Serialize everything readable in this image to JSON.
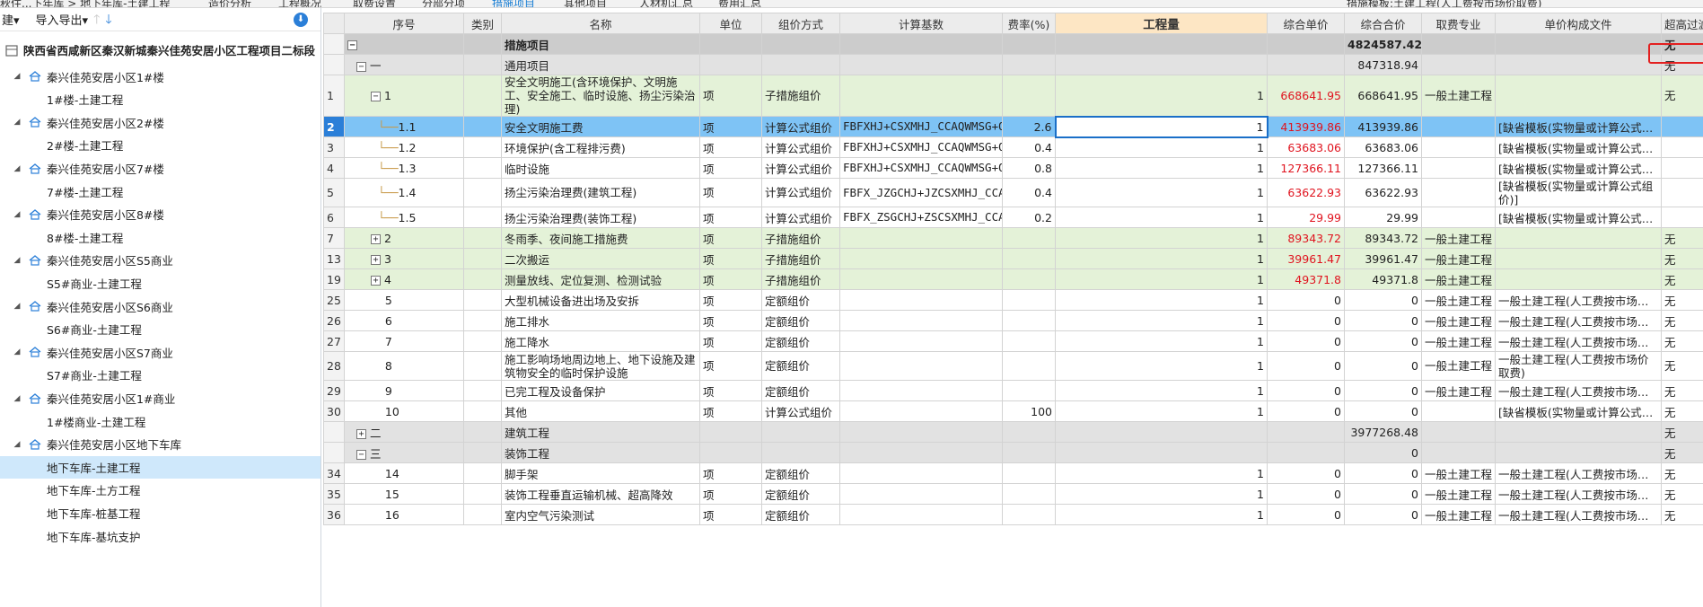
{
  "top_tabs": [
    {
      "label": "秋住...下年库 > 地下年库-土建工程",
      "active": false
    },
    {
      "label": "造价分析",
      "active": false
    },
    {
      "label": "工程概况",
      "active": false
    },
    {
      "label": "取费设置",
      "active": false
    },
    {
      "label": "分部分项",
      "active": false
    },
    {
      "label": "措施项目",
      "active": true
    },
    {
      "label": "其他项目",
      "active": false
    },
    {
      "label": "人材机汇总",
      "active": false
    },
    {
      "label": "费用汇总",
      "active": false
    },
    {
      "label": "措施模板:土建工程(人工费按市场价取费)",
      "active": false
    }
  ],
  "left_toolbar": {
    "menu_label": "建▾",
    "import_export_label": "导入导出▾"
  },
  "tree": {
    "root": "陕西省西咸新区秦汉新城秦兴佳苑安居小区工程项目二标段",
    "groups": [
      {
        "label": "秦兴佳苑安居小区1#楼",
        "children": [
          "1#楼-土建工程"
        ]
      },
      {
        "label": "秦兴佳苑安居小区2#楼",
        "children": [
          "2#楼-土建工程"
        ]
      },
      {
        "label": "秦兴佳苑安居小区7#楼",
        "children": [
          "7#楼-土建工程"
        ]
      },
      {
        "label": "秦兴佳苑安居小区8#楼",
        "children": [
          "8#楼-土建工程"
        ]
      },
      {
        "label": "秦兴佳苑安居小区S5商业",
        "children": [
          "S5#商业-土建工程"
        ]
      },
      {
        "label": "秦兴佳苑安居小区S6商业",
        "children": [
          "S6#商业-土建工程"
        ]
      },
      {
        "label": "秦兴佳苑安居小区S7商业",
        "children": [
          "S7#商业-土建工程"
        ]
      },
      {
        "label": "秦兴佳苑安居小区1#商业",
        "children": [
          "1#楼商业-土建工程"
        ]
      },
      {
        "label": "秦兴佳苑安居小区地下车库",
        "children": [
          "地下车库-土建工程",
          "地下车库-土方工程",
          "地下车库-桩基工程",
          "地下车库-基坑支护"
        ]
      }
    ],
    "selected": "地下车库-土建工程"
  },
  "grid": {
    "headers": [
      "序号",
      "类别",
      "名称",
      "单位",
      "组价方式",
      "计算基数",
      "费率(%)",
      "工程量",
      "综合单价",
      "综合合价",
      "取费专业",
      "单价构成文件",
      "超高过滤"
    ],
    "rows": [
      {
        "rn": "",
        "seq": "",
        "cls": "",
        "name": "措施项目",
        "unit": "",
        "method": "",
        "base": "",
        "rate": "",
        "qty": "",
        "price": "",
        "total": "4824587.42",
        "prof": "",
        "file": "",
        "over": "无"
      },
      {
        "rn": "",
        "seq": "一",
        "cls": "",
        "name": "通用项目",
        "unit": "",
        "method": "",
        "base": "",
        "rate": "",
        "qty": "",
        "price": "",
        "total": "847318.94",
        "prof": "",
        "file": "",
        "over": "无"
      },
      {
        "rn": "1",
        "seq": "1",
        "cls": "",
        "name": "安全文明施工(含环境保护、文明施工、安全施工、临时设施、扬尘污染治理)",
        "unit": "项",
        "method": "子措施组价",
        "base": "",
        "rate": "",
        "qty": "1",
        "price": "668641.95",
        "total": "668641.95",
        "prof": "一般土建工程",
        "file": "",
        "over": "无"
      },
      {
        "rn": "2",
        "seq": "1.1",
        "cls": "",
        "name": "安全文明施工费",
        "unit": "项",
        "method": "计算公式组价",
        "base": "FBFXHJ+CSXMHJ_CCAQWMSG+QTXMHJ",
        "rate": "2.6",
        "qty": "1",
        "price": "413939.86",
        "total": "413939.86",
        "prof": "",
        "file": "[缺省模板(实物量或计算公式组…",
        "over": ""
      },
      {
        "rn": "3",
        "seq": "1.2",
        "cls": "",
        "name": "环境保护(含工程排污费)",
        "unit": "项",
        "method": "计算公式组价",
        "base": "FBFXHJ+CSXMHJ_CCAQWMSG+QTXMHJ",
        "rate": "0.4",
        "qty": "1",
        "price": "63683.06",
        "total": "63683.06",
        "prof": "",
        "file": "[缺省模板(实物量或计算公式组…",
        "over": ""
      },
      {
        "rn": "4",
        "seq": "1.3",
        "cls": "",
        "name": "临时设施",
        "unit": "项",
        "method": "计算公式组价",
        "base": "FBFXHJ+CSXMHJ_CCAQWMSG+QTXMHJ",
        "rate": "0.8",
        "qty": "1",
        "price": "127366.11",
        "total": "127366.11",
        "prof": "",
        "file": "[缺省模板(实物量或计算公式组…",
        "over": ""
      },
      {
        "rn": "5",
        "seq": "1.4",
        "cls": "",
        "name": "扬尘污染治理费(建筑工程)",
        "unit": "项",
        "method": "计算公式组价",
        "base": "FBFX_JZGCHJ+JZCSXMHJ_CCAQWMSG+QTXMHJ",
        "rate": "0.4",
        "qty": "1",
        "price": "63622.93",
        "total": "63622.93",
        "prof": "",
        "file": "[缺省模板(实物量或计算公式组价)]",
        "over": ""
      },
      {
        "rn": "6",
        "seq": "1.5",
        "cls": "",
        "name": "扬尘污染治理费(装饰工程)",
        "unit": "项",
        "method": "计算公式组价",
        "base": "FBFX_ZSGCHJ+ZSCSXMHJ_CCAQWMSG",
        "rate": "0.2",
        "qty": "1",
        "price": "29.99",
        "total": "29.99",
        "prof": "",
        "file": "[缺省模板(实物量或计算公式组…",
        "over": ""
      },
      {
        "rn": "7",
        "seq": "2",
        "cls": "",
        "name": "冬雨季、夜间施工措施费",
        "unit": "项",
        "method": "子措施组价",
        "base": "",
        "rate": "",
        "qty": "1",
        "price": "89343.72",
        "total": "89343.72",
        "prof": "一般土建工程",
        "file": "",
        "over": "无"
      },
      {
        "rn": "13",
        "seq": "3",
        "cls": "",
        "name": "二次搬运",
        "unit": "项",
        "method": "子措施组价",
        "base": "",
        "rate": "",
        "qty": "1",
        "price": "39961.47",
        "total": "39961.47",
        "prof": "一般土建工程",
        "file": "",
        "over": "无"
      },
      {
        "rn": "19",
        "seq": "4",
        "cls": "",
        "name": "测量放线、定位复测、检测试验",
        "unit": "项",
        "method": "子措施组价",
        "base": "",
        "rate": "",
        "qty": "1",
        "price": "49371.8",
        "total": "49371.8",
        "prof": "一般土建工程",
        "file": "",
        "over": "无"
      },
      {
        "rn": "25",
        "seq": "5",
        "cls": "",
        "name": "大型机械设备进出场及安拆",
        "unit": "项",
        "method": "定额组价",
        "base": "",
        "rate": "",
        "qty": "1",
        "price": "0",
        "total": "0",
        "prof": "一般土建工程",
        "file": "一般土建工程(人工费按市场价…",
        "over": "无"
      },
      {
        "rn": "26",
        "seq": "6",
        "cls": "",
        "name": "施工排水",
        "unit": "项",
        "method": "定额组价",
        "base": "",
        "rate": "",
        "qty": "1",
        "price": "0",
        "total": "0",
        "prof": "一般土建工程",
        "file": "一般土建工程(人工费按市场价…",
        "over": "无"
      },
      {
        "rn": "27",
        "seq": "7",
        "cls": "",
        "name": "施工降水",
        "unit": "项",
        "method": "定额组价",
        "base": "",
        "rate": "",
        "qty": "1",
        "price": "0",
        "total": "0",
        "prof": "一般土建工程",
        "file": "一般土建工程(人工费按市场价…",
        "over": "无"
      },
      {
        "rn": "28",
        "seq": "8",
        "cls": "",
        "name": "施工影响场地周边地上、地下设施及建筑物安全的临时保护设施",
        "unit": "项",
        "method": "定额组价",
        "base": "",
        "rate": "",
        "qty": "1",
        "price": "0",
        "total": "0",
        "prof": "一般土建工程",
        "file": "一般土建工程(人工费按市场价取费)",
        "over": "无"
      },
      {
        "rn": "29",
        "seq": "9",
        "cls": "",
        "name": "已完工程及设备保护",
        "unit": "项",
        "method": "定额组价",
        "base": "",
        "rate": "",
        "qty": "1",
        "price": "0",
        "total": "0",
        "prof": "一般土建工程",
        "file": "一般土建工程(人工费按市场价…",
        "over": "无"
      },
      {
        "rn": "30",
        "seq": "10",
        "cls": "",
        "name": "其他",
        "unit": "项",
        "method": "计算公式组价",
        "base": "",
        "rate": "100",
        "qty": "1",
        "price": "0",
        "total": "0",
        "prof": "",
        "file": "[缺省模板(实物量或计算公式组…",
        "over": "无"
      },
      {
        "rn": "",
        "seq": "二",
        "cls": "",
        "name": "建筑工程",
        "unit": "",
        "method": "",
        "base": "",
        "rate": "",
        "qty": "",
        "price": "",
        "total": "3977268.48",
        "prof": "",
        "file": "",
        "over": "无"
      },
      {
        "rn": "",
        "seq": "三",
        "cls": "",
        "name": "装饰工程",
        "unit": "",
        "method": "",
        "base": "",
        "rate": "",
        "qty": "",
        "price": "",
        "total": "0",
        "prof": "",
        "file": "",
        "over": "无"
      },
      {
        "rn": "34",
        "seq": "14",
        "cls": "",
        "name": "脚手架",
        "unit": "项",
        "method": "定额组价",
        "base": "",
        "rate": "",
        "qty": "1",
        "price": "0",
        "total": "0",
        "prof": "一般土建工程",
        "file": "一般土建工程(人工费按市场价…",
        "over": "无"
      },
      {
        "rn": "35",
        "seq": "15",
        "cls": "",
        "name": "装饰工程垂直运输机械、超高降效",
        "unit": "项",
        "method": "定额组价",
        "base": "",
        "rate": "",
        "qty": "1",
        "price": "0",
        "total": "0",
        "prof": "一般土建工程",
        "file": "一般土建工程(人工费按市场价…",
        "over": "无"
      },
      {
        "rn": "36",
        "seq": "16",
        "cls": "",
        "name": "室内空气污染测试",
        "unit": "项",
        "method": "定额组价",
        "base": "",
        "rate": "",
        "qty": "1",
        "price": "0",
        "total": "0",
        "prof": "一般土建工程",
        "file": "一般土建工程(人工费按市场价…",
        "over": "无"
      }
    ]
  },
  "colors": {
    "accent": "#2b7fd8",
    "highlight_total_border": "#e32020",
    "price_text": "#e0141f",
    "selected_row": "#7ec3f5",
    "sub_row": "#e4f2d8"
  }
}
